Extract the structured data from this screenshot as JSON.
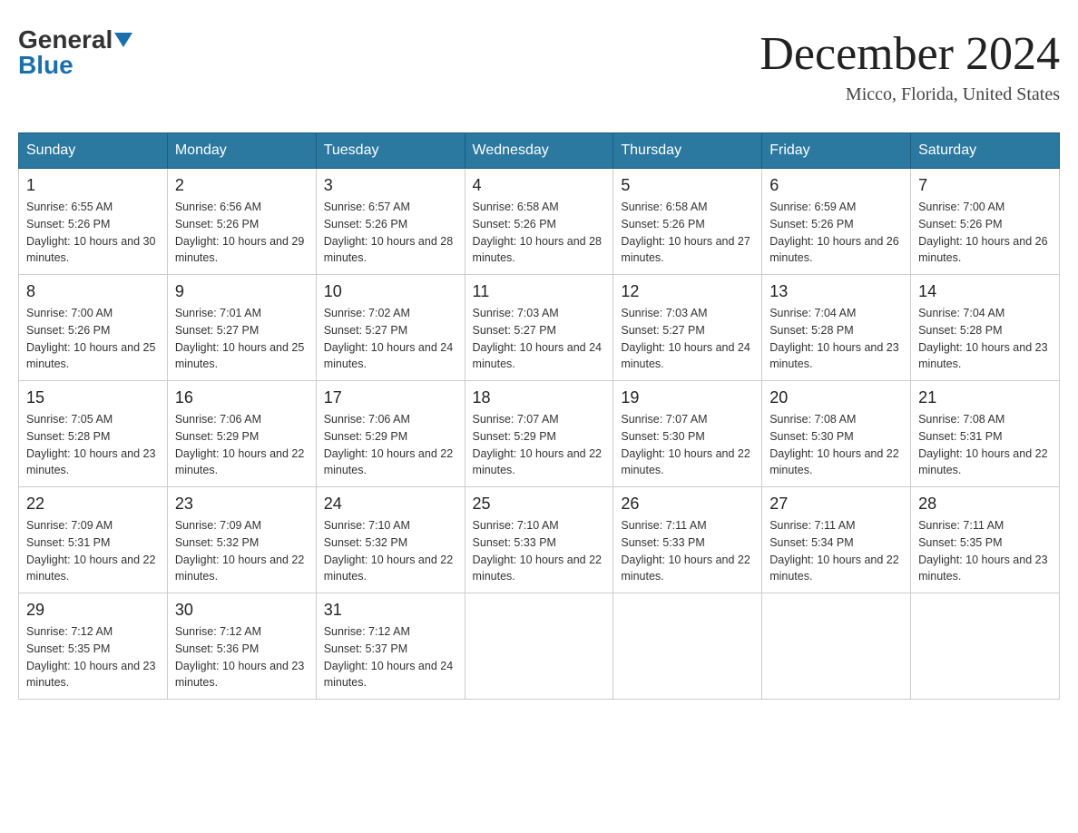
{
  "header": {
    "logo_general": "General",
    "logo_blue": "Blue",
    "month_title": "December 2024",
    "location": "Micco, Florida, United States"
  },
  "days_of_week": [
    "Sunday",
    "Monday",
    "Tuesday",
    "Wednesday",
    "Thursday",
    "Friday",
    "Saturday"
  ],
  "weeks": [
    [
      {
        "day": "1",
        "sunrise": "6:55 AM",
        "sunset": "5:26 PM",
        "daylight": "10 hours and 30 minutes."
      },
      {
        "day": "2",
        "sunrise": "6:56 AM",
        "sunset": "5:26 PM",
        "daylight": "10 hours and 29 minutes."
      },
      {
        "day": "3",
        "sunrise": "6:57 AM",
        "sunset": "5:26 PM",
        "daylight": "10 hours and 28 minutes."
      },
      {
        "day": "4",
        "sunrise": "6:58 AM",
        "sunset": "5:26 PM",
        "daylight": "10 hours and 28 minutes."
      },
      {
        "day": "5",
        "sunrise": "6:58 AM",
        "sunset": "5:26 PM",
        "daylight": "10 hours and 27 minutes."
      },
      {
        "day": "6",
        "sunrise": "6:59 AM",
        "sunset": "5:26 PM",
        "daylight": "10 hours and 26 minutes."
      },
      {
        "day": "7",
        "sunrise": "7:00 AM",
        "sunset": "5:26 PM",
        "daylight": "10 hours and 26 minutes."
      }
    ],
    [
      {
        "day": "8",
        "sunrise": "7:00 AM",
        "sunset": "5:26 PM",
        "daylight": "10 hours and 25 minutes."
      },
      {
        "day": "9",
        "sunrise": "7:01 AM",
        "sunset": "5:27 PM",
        "daylight": "10 hours and 25 minutes."
      },
      {
        "day": "10",
        "sunrise": "7:02 AM",
        "sunset": "5:27 PM",
        "daylight": "10 hours and 24 minutes."
      },
      {
        "day": "11",
        "sunrise": "7:03 AM",
        "sunset": "5:27 PM",
        "daylight": "10 hours and 24 minutes."
      },
      {
        "day": "12",
        "sunrise": "7:03 AM",
        "sunset": "5:27 PM",
        "daylight": "10 hours and 24 minutes."
      },
      {
        "day": "13",
        "sunrise": "7:04 AM",
        "sunset": "5:28 PM",
        "daylight": "10 hours and 23 minutes."
      },
      {
        "day": "14",
        "sunrise": "7:04 AM",
        "sunset": "5:28 PM",
        "daylight": "10 hours and 23 minutes."
      }
    ],
    [
      {
        "day": "15",
        "sunrise": "7:05 AM",
        "sunset": "5:28 PM",
        "daylight": "10 hours and 23 minutes."
      },
      {
        "day": "16",
        "sunrise": "7:06 AM",
        "sunset": "5:29 PM",
        "daylight": "10 hours and 22 minutes."
      },
      {
        "day": "17",
        "sunrise": "7:06 AM",
        "sunset": "5:29 PM",
        "daylight": "10 hours and 22 minutes."
      },
      {
        "day": "18",
        "sunrise": "7:07 AM",
        "sunset": "5:29 PM",
        "daylight": "10 hours and 22 minutes."
      },
      {
        "day": "19",
        "sunrise": "7:07 AM",
        "sunset": "5:30 PM",
        "daylight": "10 hours and 22 minutes."
      },
      {
        "day": "20",
        "sunrise": "7:08 AM",
        "sunset": "5:30 PM",
        "daylight": "10 hours and 22 minutes."
      },
      {
        "day": "21",
        "sunrise": "7:08 AM",
        "sunset": "5:31 PM",
        "daylight": "10 hours and 22 minutes."
      }
    ],
    [
      {
        "day": "22",
        "sunrise": "7:09 AM",
        "sunset": "5:31 PM",
        "daylight": "10 hours and 22 minutes."
      },
      {
        "day": "23",
        "sunrise": "7:09 AM",
        "sunset": "5:32 PM",
        "daylight": "10 hours and 22 minutes."
      },
      {
        "day": "24",
        "sunrise": "7:10 AM",
        "sunset": "5:32 PM",
        "daylight": "10 hours and 22 minutes."
      },
      {
        "day": "25",
        "sunrise": "7:10 AM",
        "sunset": "5:33 PM",
        "daylight": "10 hours and 22 minutes."
      },
      {
        "day": "26",
        "sunrise": "7:11 AM",
        "sunset": "5:33 PM",
        "daylight": "10 hours and 22 minutes."
      },
      {
        "day": "27",
        "sunrise": "7:11 AM",
        "sunset": "5:34 PM",
        "daylight": "10 hours and 22 minutes."
      },
      {
        "day": "28",
        "sunrise": "7:11 AM",
        "sunset": "5:35 PM",
        "daylight": "10 hours and 23 minutes."
      }
    ],
    [
      {
        "day": "29",
        "sunrise": "7:12 AM",
        "sunset": "5:35 PM",
        "daylight": "10 hours and 23 minutes."
      },
      {
        "day": "30",
        "sunrise": "7:12 AM",
        "sunset": "5:36 PM",
        "daylight": "10 hours and 23 minutes."
      },
      {
        "day": "31",
        "sunrise": "7:12 AM",
        "sunset": "5:37 PM",
        "daylight": "10 hours and 24 minutes."
      },
      null,
      null,
      null,
      null
    ]
  ]
}
